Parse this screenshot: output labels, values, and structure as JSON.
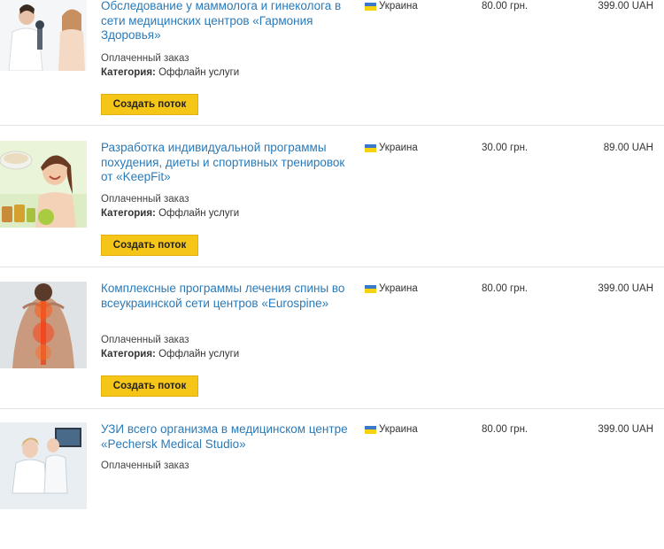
{
  "orders": [
    {
      "title": "Обследование у маммолога и гинеколога в сети медицинских центров «Гармония Здоровья»",
      "status": "Оплаченный заказ",
      "category_label": "Категория:",
      "category_value": "Оффлайн услуги",
      "button": "Создать поток",
      "country": "Украина",
      "price": "80.00 грн.",
      "total": "399.00 UAH"
    },
    {
      "title": "Разработка индивидуальной программы похудения, диеты и спортивных тренировок от «KeepFit»",
      "status": "Оплаченный заказ",
      "category_label": "Категория:",
      "category_value": "Оффлайн услуги",
      "button": "Создать поток",
      "country": "Украина",
      "price": "30.00 грн.",
      "total": "89.00 UAH"
    },
    {
      "title": "Комплексные программы лечения спины во всеукраинской сети центров «Eurospine»",
      "status": "Оплаченный заказ",
      "category_label": "Категория:",
      "category_value": "Оффлайн услуги",
      "button": "Создать поток",
      "country": "Украина",
      "price": "80.00 грн.",
      "total": "399.00 UAH"
    },
    {
      "title": "УЗИ всего организма в медицинском центре «Pechersk Medical Studio»",
      "status": "Оплаченный заказ",
      "country": "Украина",
      "price": "80.00 грн.",
      "total": "399.00 UAH"
    }
  ]
}
